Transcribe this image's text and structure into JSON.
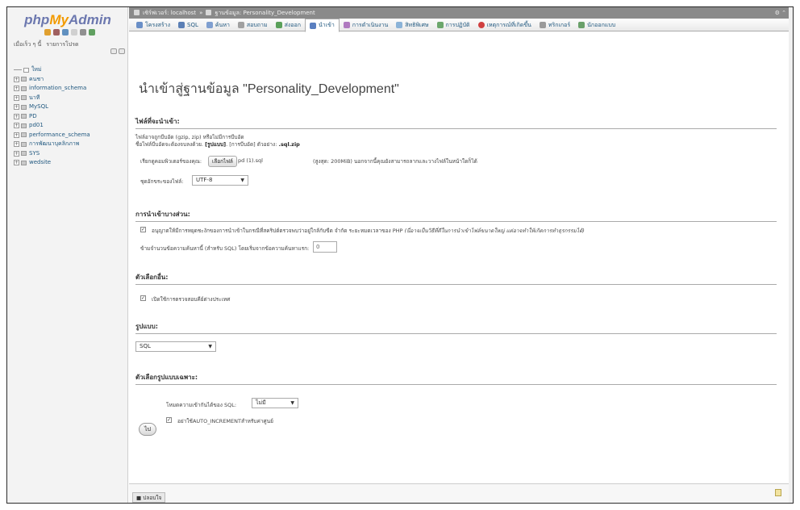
{
  "nav": {
    "logo_php": "php",
    "logo_my": "My",
    "logo_admin": "Admin",
    "links": [
      "เมื่อเร็ว ๆ นี้",
      "รายการโปรด"
    ],
    "tree": [
      {
        "label": "ใหม่",
        "type": "new"
      },
      {
        "label": "คนชา",
        "type": "db"
      },
      {
        "label": "information_schema",
        "type": "db"
      },
      {
        "label": "นาที",
        "type": "db"
      },
      {
        "label": "MySQL",
        "type": "db"
      },
      {
        "label": "PD",
        "type": "db"
      },
      {
        "label": "pd01",
        "type": "db"
      },
      {
        "label": "performance_schema",
        "type": "db"
      },
      {
        "label": "การพัฒนาบุคลิกภาพ",
        "type": "db"
      },
      {
        "label": "SYS",
        "type": "db"
      },
      {
        "label": "wedsite",
        "type": "db"
      }
    ]
  },
  "breadcrumb": {
    "server": "เซิร์ฟเวอร์: localhost",
    "sep": "»",
    "database": "ฐานข้อมูล: Personality_Development"
  },
  "tabs": [
    {
      "label": "โครงสร้าง",
      "color": "#6a8fc7"
    },
    {
      "label": "SQL",
      "color": "#5b7fb5"
    },
    {
      "label": "ค้นหา",
      "color": "#7f9fd0"
    },
    {
      "label": "สอบถาม",
      "color": "#a0a0a0"
    },
    {
      "label": "ส่งออก",
      "color": "#5aa05a"
    },
    {
      "label": "นำเข้า",
      "color": "#5a7fc0",
      "active": true
    },
    {
      "label": "การดำเนินงาน",
      "color": "#b07ac0"
    },
    {
      "label": "สิทธิพิเศษ",
      "color": "#8bb3d8"
    },
    {
      "label": "การปฏิบัติ",
      "color": "#6ca76c"
    },
    {
      "label": "เหตุการณ์ที่เกิดขึ้น",
      "color": "#d04040"
    },
    {
      "label": "ทริกเกอร์",
      "color": "#9a9a9a"
    },
    {
      "label": "นักออกแบบ",
      "color": "#6aa06a"
    }
  ],
  "main": {
    "title": "นำเข้าสู่ฐานข้อมูล \"Personality_Development\"",
    "file_section": {
      "heading": "ไฟล์ที่จะนำเข้า:",
      "line1": "ไฟล์อาจถูกบีบอัด (gzip, zip) หรือไม่มีการบีบอัด",
      "line2_prefix": "ชื่อไฟล์บีบอัดจะต้องจบลงด้วย.",
      "line2_format": "[รูปแบบ]",
      "line2_mid": ". [การบีบอัด] ตัวอย่าง:",
      "line2_example": ".sql.zip",
      "browse_label": "เรียกดูคอมพิวเตอร์ของคุณ:",
      "choose_button": "เลือกไฟล์",
      "chosen_file": "pd (1).sql",
      "max_size": "(สูงสุด: 200MiB) นอกจากนี้คุณยังสามารถลากและวางไฟล์ในหน้าใดก็ได้",
      "charset_label": "ชุดอักขระของไฟล์:",
      "charset_value": "UTF-8"
    },
    "partial_section": {
      "heading": "การนำเข้าบางส่วน:",
      "allow_interrupt": "อนุญาตให้มีการหยุดชะงักของการนำเข้าในกรณีที่สคริปต์ตรวจพบว่าอยู่ใกล้กับขีด จำกัด ระยะหมดเวลาของ PHP",
      "allow_interrupt_note": "(นี่อาจเป็นวิธีที่ดีในการนำเข้าไฟล์ขนาดใหญ่ แต่อาจทำให้เกิดการทำธุรกรรมได้)",
      "skip_label": "ข้ามจำนวนข้อความค้นหานี้ (สำหรับ SQL) โดยเริ่มจากข้อความค้นหาแรก:",
      "skip_value": "0"
    },
    "other_section": {
      "heading": "ตัวเลือกอื่น:",
      "fk_checks": "เปิดใช้การตรวจสอบคีย์ต่างประเทศ"
    },
    "format_section": {
      "heading": "รูปแบบ:",
      "format_value": "SQL"
    },
    "format_options_section": {
      "heading": "ตัวเลือกรูปแบบเฉพาะ:",
      "compat_label": "โหมดความเข้ากันได้ของ SQL:",
      "compat_value": "ไม่มี",
      "no_auto_value": "อย่าใช้AUTO_INCREMENTสำหรับค่าศูนย์"
    },
    "go_button": "ไป"
  },
  "footer": {
    "console": "ปลอบใจ"
  }
}
